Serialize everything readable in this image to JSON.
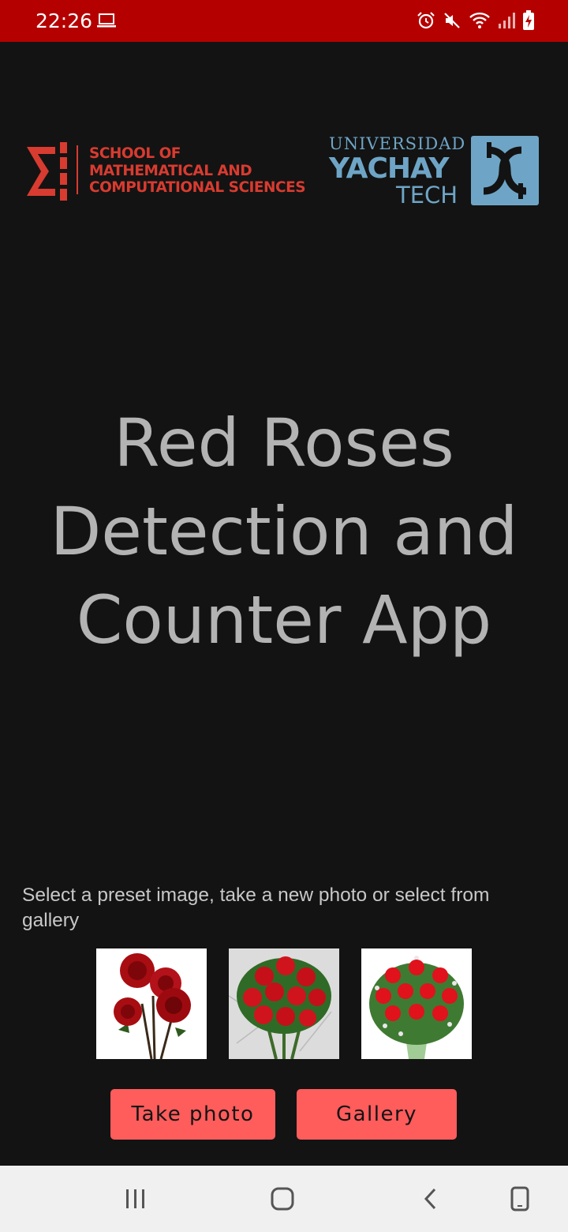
{
  "status_bar": {
    "time": "22:26",
    "left_icons": [
      "laptop-icon"
    ],
    "right_icons": [
      "alarm-icon",
      "mute-icon",
      "wifi-icon",
      "signal-icon",
      "battery-charging-icon"
    ]
  },
  "logos": {
    "school": {
      "lines": [
        "SCHOOL OF",
        "MATHEMATICAL AND",
        "COMPUTATIONAL SCIENCES"
      ],
      "color": "#d83b30"
    },
    "university": {
      "line1": "UNIVERSIDAD",
      "line2": "YACHAY",
      "line3": "TECH",
      "color": "#6ea5c6"
    }
  },
  "main": {
    "title_lines": [
      "Red Roses",
      "Detection and",
      "Counter App"
    ],
    "instructions": "Select a preset image, take a new photo or select from gallery",
    "presets": [
      {
        "icon": "rose-bouquet-small-image"
      },
      {
        "icon": "rose-bouquet-marble-image"
      },
      {
        "icon": "rose-vase-image"
      }
    ],
    "take_photo_label": "Take photo",
    "gallery_label": "Gallery"
  },
  "colors": {
    "status_bar": "#b50000",
    "background": "#131313",
    "button": "#ff5c5c",
    "title": "#b3b3b3"
  },
  "nav": {
    "buttons": [
      "recent-apps-icon",
      "home-icon",
      "back-icon",
      "rotate-icon"
    ]
  }
}
